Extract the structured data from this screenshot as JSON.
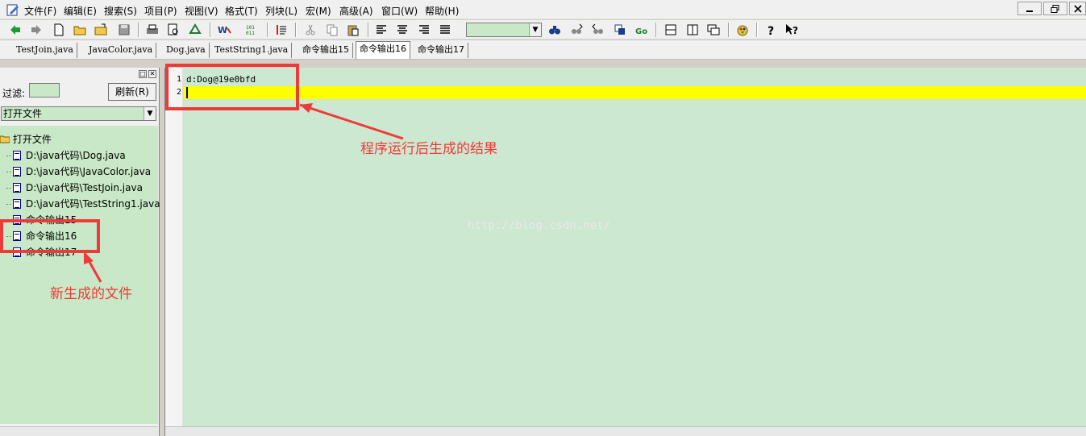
{
  "menu": {
    "items": [
      "文件(F)",
      "编辑(E)",
      "搜索(S)",
      "项目(P)",
      "视图(V)",
      "格式(T)",
      "列块(L)",
      "宏(M)",
      "高级(A)",
      "窗口(W)",
      "帮助(H)"
    ]
  },
  "window_controls": [
    "minimize-icon",
    "restore-icon",
    "close-icon"
  ],
  "toolbar": {
    "icons": [
      "back-arrow-icon",
      "forward-arrow-icon",
      "new-file-icon",
      "open-folder-icon",
      "open-icon",
      "save-icon",
      "print-icon",
      "print-preview-icon",
      "recycle-icon",
      "word-wrap-icon",
      "hex-icon",
      "column-mode-icon",
      "cut-icon",
      "copy-icon",
      "paste-icon",
      "align-left-icon",
      "align-center-icon",
      "align-right-icon",
      "justify-icon",
      "find-icon",
      "find-next-icon",
      "find-prev-icon",
      "replace-icon",
      "goto-icon",
      "split-h-icon",
      "split-v-icon",
      "window-icon",
      "palette-icon",
      "help-icon",
      "context-help-icon"
    ],
    "combo_value": ""
  },
  "tabs": [
    {
      "label": "TestJoin.java"
    },
    {
      "label": "JavaColor.java"
    },
    {
      "label": "Dog.java"
    },
    {
      "label": "TestString1.java"
    },
    {
      "label": "命令输出15"
    },
    {
      "label": "命令输出16",
      "active": true
    },
    {
      "label": "命令输出17"
    }
  ],
  "left_panel": {
    "filter_label": "过滤:",
    "filter_value": "",
    "refresh_label": "刷新(R)",
    "file_select_value": "打开文件",
    "tree_root": "打开文件",
    "tree_items": [
      "D:\\java代码\\Dog.java",
      "D:\\java代码\\JavaColor.java",
      "D:\\java代码\\TestJoin.java",
      "D:\\java代码\\TestString1.java",
      "命令输出15",
      "命令输出16",
      "命令输出17"
    ]
  },
  "editor": {
    "lines": [
      {
        "number": "1",
        "text": "d:Dog@19e0bfd"
      },
      {
        "number": "2",
        "text": ""
      }
    ],
    "watermark": "http://blog.csdn.net/"
  },
  "annotations": {
    "result_note": "程序运行后生成的结果",
    "new_file_note": "新生成的文件",
    "color": "#ef3a3a"
  },
  "colors": {
    "editor_bg": "#cce8d0",
    "current_line": "#ffff00",
    "annotation": "#ef3a3a"
  }
}
